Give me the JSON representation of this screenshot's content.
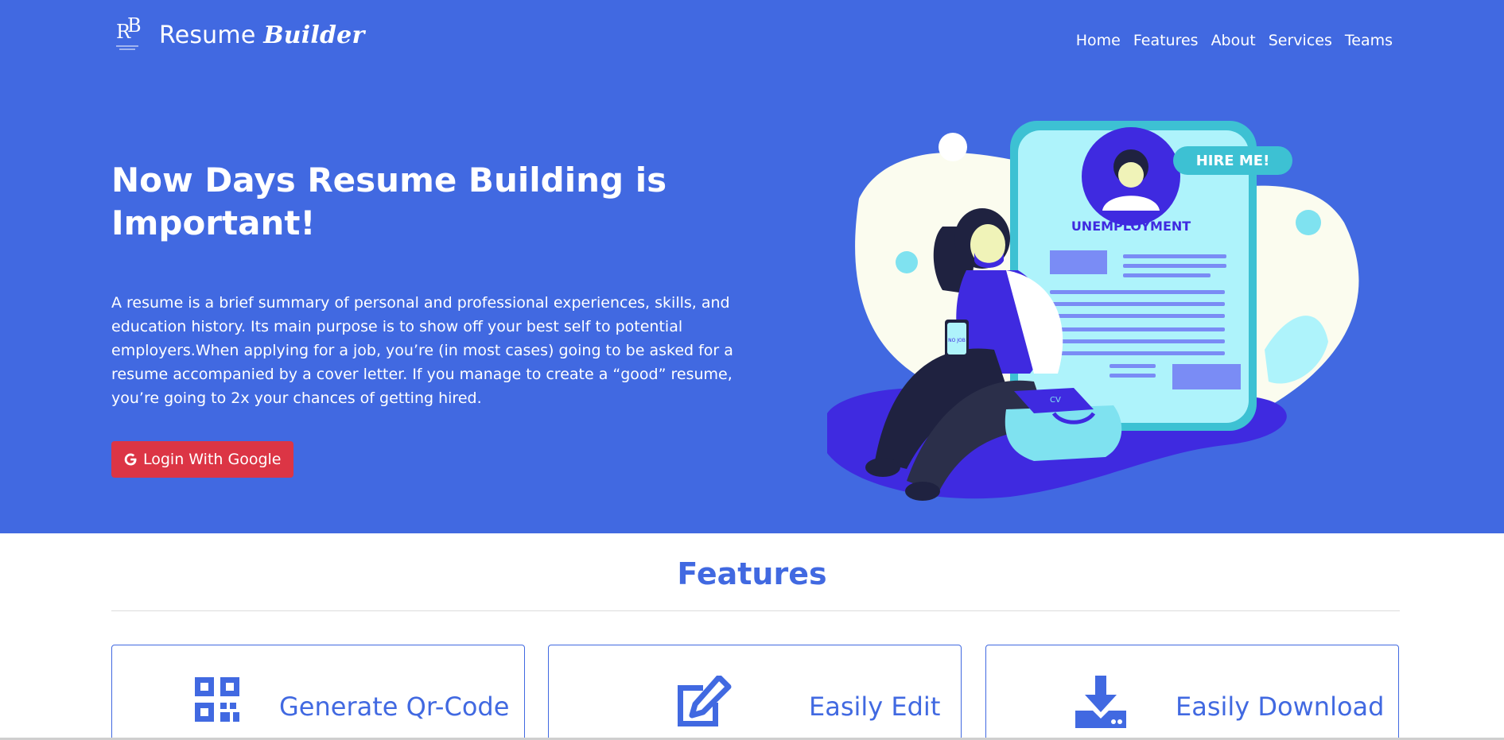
{
  "brand": {
    "name": "Resume Builder",
    "name_plain": "Resume ",
    "name_styled": "Builder",
    "logo_letters": "RB"
  },
  "nav": {
    "items": [
      {
        "label": "Home"
      },
      {
        "label": "Features"
      },
      {
        "label": "About"
      },
      {
        "label": "Services"
      },
      {
        "label": "Teams"
      }
    ]
  },
  "hero": {
    "title": "Now Days Resume Building is Important!",
    "description": "A resume is a brief summary of personal and professional experiences, skills, and education history. Its main purpose is to show off your best self to potential employers.When applying for a job, you’re (in most cases) going to be asked for a resume accompanied by a cover letter. If you manage to create a “good” resume, you’re going to 2x your chances of getting hired.",
    "login_button_label": "Login With Google",
    "illustration": {
      "bubble_text": "HIRE ME!",
      "card_heading": "UNEMPLOYMENT",
      "folder_label": "CV",
      "phone_text": "NO JOB"
    }
  },
  "features": {
    "title": "Features",
    "cards": [
      {
        "title": "Generate Qr-Code",
        "icon": "qrcode-icon"
      },
      {
        "title": "Easily Edit",
        "icon": "edit-icon"
      },
      {
        "title": "Easily Download",
        "icon": "download-icon"
      }
    ]
  },
  "colors": {
    "primary": "#4169e1",
    "danger": "#dc3545",
    "white": "#ffffff"
  }
}
